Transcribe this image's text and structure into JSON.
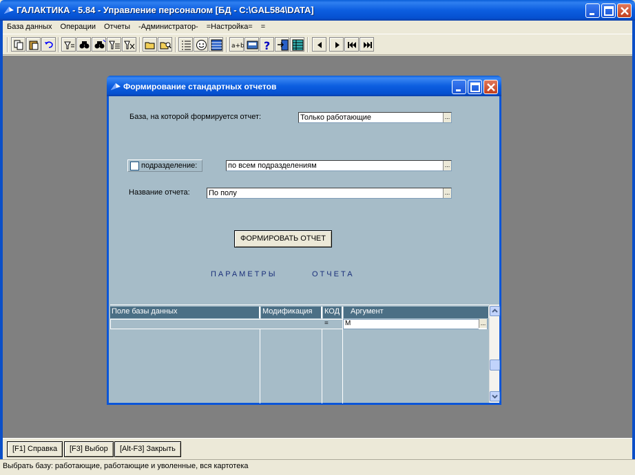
{
  "app": {
    "title": "ГАЛАКТИКА - 5.84 - Управление персоналом [БД - C:\\GAL584\\DATA]"
  },
  "menu": {
    "items": [
      "База данных",
      "Операции",
      "Отчеты",
      "-Администратор-",
      "=Настройка=",
      "="
    ]
  },
  "toolbar": {
    "icons": [
      "copy-icon",
      "paste-icon",
      "undo-icon",
      "filter-icon",
      "find-icon",
      "find-next-icon",
      "filter-select-icon",
      "filter-clear-icon",
      "open-folder-icon",
      "search-folder-icon",
      "list-icon",
      "smiley-icon",
      "table-icon",
      "replace-icon",
      "calculator-icon",
      "help-icon",
      "exit-icon",
      "grid-icon",
      "prev-icon",
      "next-icon",
      "first-icon",
      "last-icon"
    ]
  },
  "dialog": {
    "title": "Формирование стандартных отчетов",
    "base_label": "База, на которой формируется отчет:",
    "base_value": "Только работающие",
    "dept_checkbox_label": "подразделение:",
    "dept_checked": false,
    "dept_value": "по всем подразделениям",
    "report_label": "Название отчета:",
    "report_value": "По полу",
    "form_button": "ФОРМИРОВАТЬ ОТЧЕТ",
    "params_left": "ПАРАМЕТРЫ",
    "params_right": "ОТЧЕТА",
    "grid": {
      "columns": [
        "Поле базы данных",
        "Модификация",
        "КОД",
        "Аргумент"
      ],
      "rows": [
        {
          "field": "",
          "mod": "",
          "code": "=",
          "arg": "М"
        }
      ]
    }
  },
  "bottom": {
    "help": "[F1] Справка",
    "select": "[F3] Выбор",
    "close": "[Alt-F3] Закрыть"
  },
  "status": {
    "text": "Выбрать базу: работающие, работающие и уволенные, вся картотека"
  },
  "colors": {
    "titlebar": "#0c5ee0",
    "workspace": "#808080",
    "dialog_body": "#a6bcc8",
    "grid_header": "#4b6f85"
  }
}
